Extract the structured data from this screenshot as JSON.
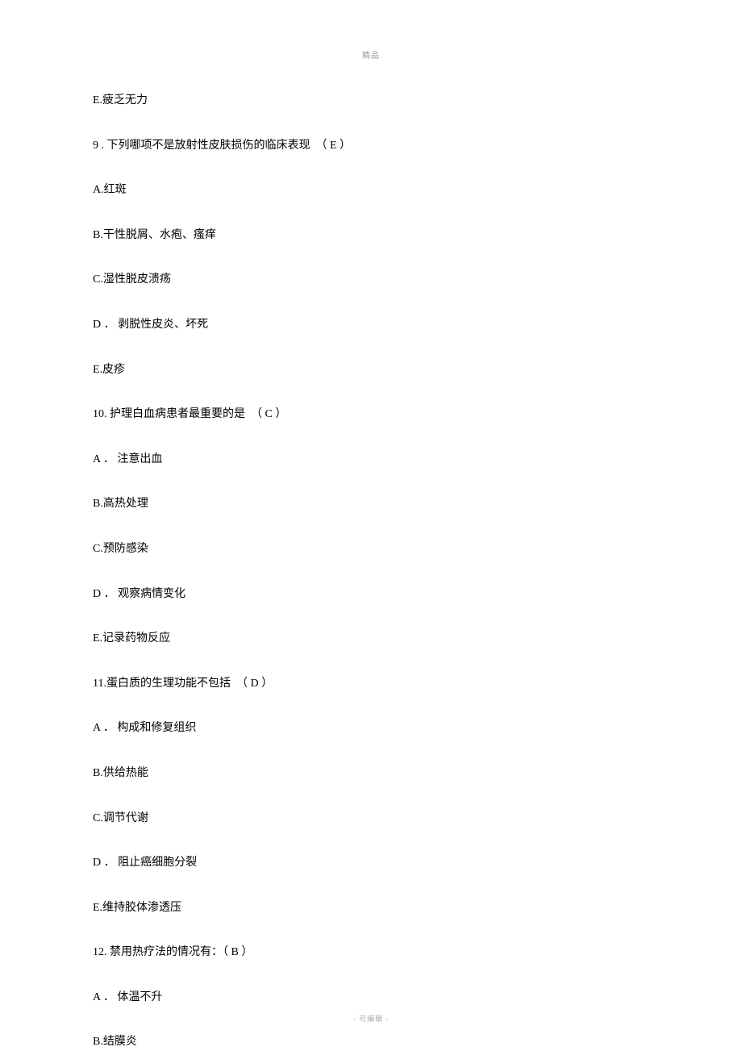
{
  "header": "精品",
  "footer": "- 可编辑 -",
  "lines": {
    "l0": "E.疲乏无力",
    "q9": "9 . 下列哪项不是放射性皮肤损伤的临床表现　（ E ）",
    "q9a": "A.红斑",
    "q9b": "B.干性脱屑、水疱、瘙痒",
    "q9c": "C.湿性脱皮溃疡",
    "q9d": "D ． 剥脱性皮炎、坏死",
    "q9e": "E.皮疹",
    "q10": "10. 护理白血病患者最重要的是　（ C ）",
    "q10a": "A ． 注意出血",
    "q10b": "B.高热处理",
    "q10c": "C.预防感染",
    "q10d": "D ． 观察病情变化",
    "q10e": "E.记录药物反应",
    "q11": "11.蛋白质的生理功能不包括　（ D ）",
    "q11a": "A ． 构成和修复组织",
    "q11b": "B.供给热能",
    "q11c": "C.调节代谢",
    "q11d": "D ． 阻止癌细胞分裂",
    "q11e": "E.维持胶体渗透压",
    "q12": "12. 禁用热疗法的情况有：（ B ）",
    "q12a": "A ． 体温不升",
    "q12b": "B.结膜炎"
  }
}
